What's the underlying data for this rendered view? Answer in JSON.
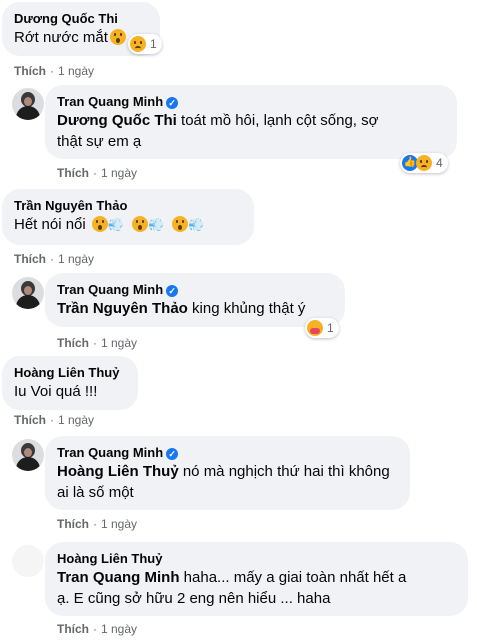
{
  "actions": {
    "like": "Thích",
    "separator": "·",
    "time": "1 ngày"
  },
  "comments": [
    {
      "author": "Dương Quốc Thi",
      "text": "Rớt nước mắt",
      "reaction_count": "1",
      "reaction_icons": [
        "sad-icon"
      ]
    },
    {
      "author": "Tran Quang Minh",
      "verified": true,
      "mention": "Dương Quốc Thi",
      "text": " toát mồ hôi, lạnh cột sống, sợ",
      "text2": "thật sự em ạ",
      "reaction_count": "4",
      "reaction_icons": [
        "like-icon",
        "sad-icon"
      ]
    },
    {
      "author": "Trần Nguyên Thảo",
      "text": "Hết nói nổi",
      "emoji_sequence": [
        "surprised-face-puff",
        "surprised-face-puff",
        "surprised-face-puff"
      ]
    },
    {
      "author": "Tran Quang Minh",
      "verified": true,
      "mention": "Trần Nguyên Thảo",
      "text": " king khủng thật ý",
      "reaction_count": "1",
      "reaction_icons": [
        "care-icon"
      ]
    },
    {
      "author": "Hoàng Liên Thuỷ",
      "text": "Iu Voi quá !!!"
    },
    {
      "author": "Tran Quang Minh",
      "verified": true,
      "mention": "Hoàng Liên Thuỷ",
      "text": " nó mà nghịch thứ hai thì không",
      "text2": "ai là số một"
    },
    {
      "author": "Hoàng Liên Thuỷ",
      "mention": "Tran Quang Minh",
      "text": " haha... mấy a giai toàn nhất hết a",
      "text2": "ạ. E cũng sở hữu 2 eng nên hiểu ... haha"
    }
  ],
  "colors": {
    "bubble": "#f0f2f5",
    "meta": "#65676b",
    "verified": "#1877f2",
    "text": "#050505"
  }
}
